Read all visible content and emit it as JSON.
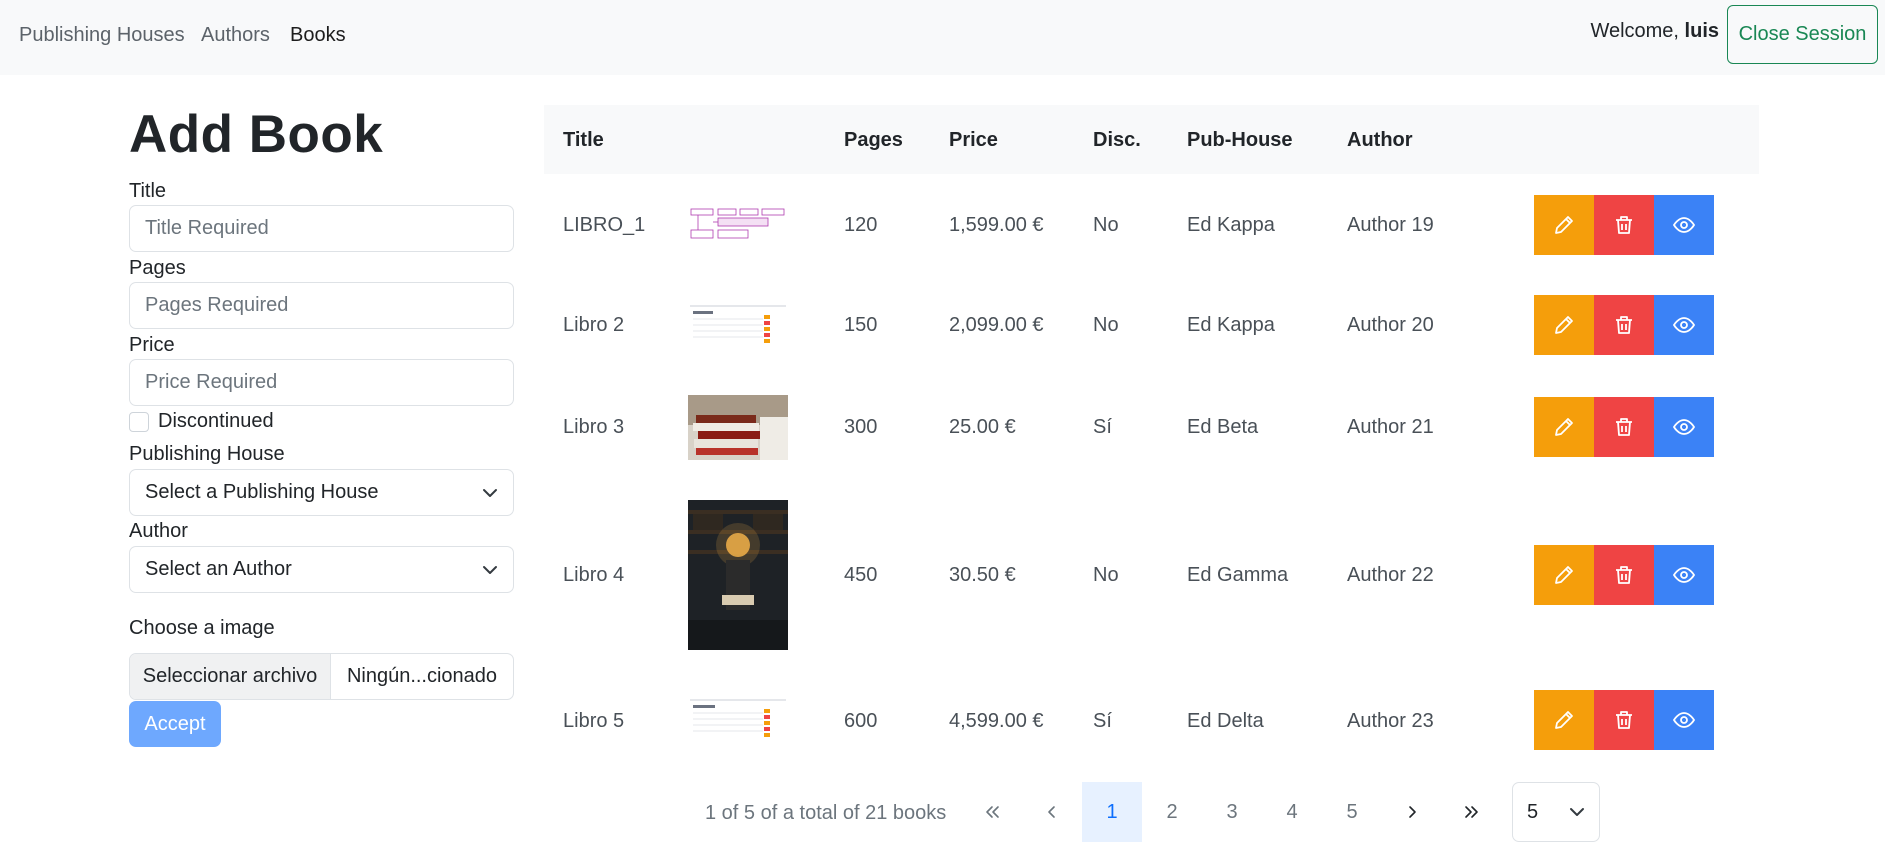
{
  "nav": {
    "links": [
      "Publishing Houses",
      "Authors",
      "Books"
    ],
    "welcome_prefix": "Welcome,",
    "username": "luis",
    "close_session": "Close Session"
  },
  "form": {
    "title": "Add Book",
    "title_label": "Title",
    "title_placeholder": "Title Required",
    "pages_label": "Pages",
    "pages_placeholder": "Pages Required",
    "price_label": "Price",
    "price_placeholder": "Price Required",
    "discontinued_label": "Discontinued",
    "discontinued_checked": false,
    "pubhouse_label": "Publishing House",
    "pubhouse_selected": "Select a Publishing House",
    "author_label": "Author",
    "author_selected": "Select an Author",
    "image_label": "Choose a image",
    "file_button": "Seleccionar archivo",
    "file_name": "Ningún...cionado",
    "accept": "Accept"
  },
  "table": {
    "headers": [
      "Title",
      "Pages",
      "Price",
      "Disc.",
      "Pub-House",
      "Author"
    ],
    "rows": [
      {
        "title": "LIBRO_1",
        "pages": "120",
        "price": "1,599.00 €",
        "disc": "No",
        "pubhouse": "Ed Kappa",
        "author": "Author 19",
        "thumb": "diagram-thumbnail"
      },
      {
        "title": "Libro 2",
        "pages": "150",
        "price": "2,099.00 €",
        "disc": "No",
        "pubhouse": "Ed Kappa",
        "author": "Author 20",
        "thumb": "screenshot-thumbnail"
      },
      {
        "title": "Libro 3",
        "pages": "300",
        "price": "25.00 €",
        "disc": "Sí",
        "pubhouse": "Ed Beta",
        "author": "Author 21",
        "thumb": "book-stack-photo"
      },
      {
        "title": "Libro 4",
        "pages": "450",
        "price": "30.50 €",
        "disc": "No",
        "pubhouse": "Ed Gamma",
        "author": "Author 22",
        "thumb": "library-reading-photo"
      },
      {
        "title": "Libro 5",
        "pages": "600",
        "price": "4,599.00 €",
        "disc": "Sí",
        "pubhouse": "Ed Delta",
        "author": "Author 23",
        "thumb": "screenshot-thumbnail"
      }
    ]
  },
  "pagination": {
    "info": "1 of 5 of a total of 21 books",
    "pages": [
      "1",
      "2",
      "3",
      "4",
      "5"
    ],
    "current": "1",
    "first_icon": "double-chevron-left-icon",
    "prev_icon": "chevron-left-icon",
    "next_icon": "chevron-right-icon",
    "last_icon": "double-chevron-right-icon",
    "page_size": "5"
  },
  "colors": {
    "edit": "#f59e0b",
    "delete": "#ef4444",
    "view": "#3b82f6",
    "accept": "#6ea8fe",
    "close_session": "#198754"
  }
}
